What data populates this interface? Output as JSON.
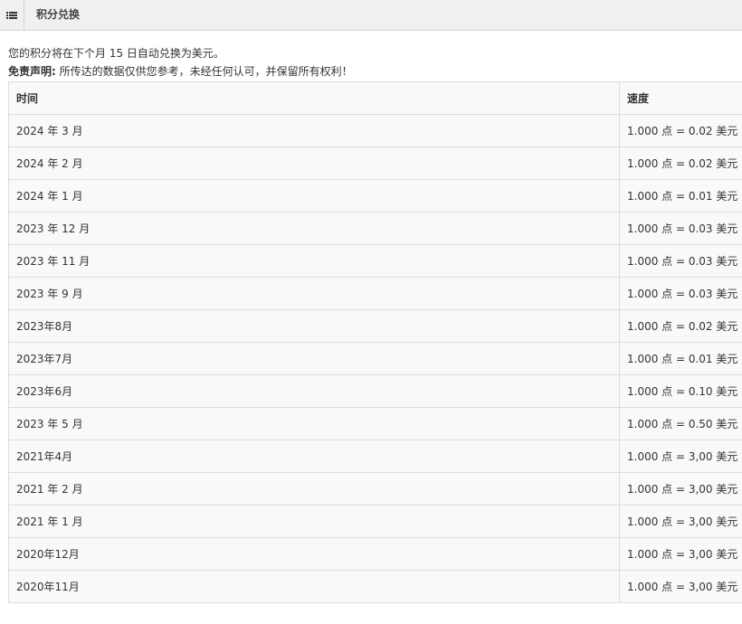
{
  "header": {
    "title": "积分兑换",
    "menu_icon": "list-icon"
  },
  "info": {
    "notice": "您的积分将在下个月 15 日自动兑换为美元。",
    "disclaimer_label": "免责声明:",
    "disclaimer_text": "所传达的数据仅供您参考，未经任何认可，并保留所有权利！"
  },
  "table": {
    "columns": [
      "时间",
      "速度"
    ],
    "rows": [
      {
        "time": "2024 年 3 月",
        "rate": "1.000 点 = 0.02 美元"
      },
      {
        "time": "2024 年 2 月",
        "rate": "1.000 点 = 0.02 美元"
      },
      {
        "time": "2024 年 1 月",
        "rate": "1.000 点 = 0.01 美元"
      },
      {
        "time": "2023 年 12 月",
        "rate": "1.000 点 = 0.03 美元"
      },
      {
        "time": "2023 年 11 月",
        "rate": "1.000 点 = 0.03 美元"
      },
      {
        "time": "2023 年 9 月",
        "rate": "1.000 点 = 0.03 美元"
      },
      {
        "time": "2023年8月",
        "rate": "1.000 点 = 0.02 美元"
      },
      {
        "time": "2023年7月",
        "rate": "1.000 点 = 0.01 美元"
      },
      {
        "time": "2023年6月",
        "rate": "1.000 点 = 0.10 美元"
      },
      {
        "time": "2023 年 5 月",
        "rate": "1.000 点 = 0.50 美元"
      },
      {
        "time": "2021年4月",
        "rate": "1.000 点 = 3,00 美元"
      },
      {
        "time": "2021 年 2 月",
        "rate": "1.000 点 = 3,00 美元"
      },
      {
        "time": "2021 年 1 月",
        "rate": "1.000 点 = 3,00 美元"
      },
      {
        "time": "2020年12月",
        "rate": "1.000 点 = 3,00 美元"
      },
      {
        "time": "2020年11月",
        "rate": "1.000 点 = 3,00 美元"
      }
    ]
  }
}
